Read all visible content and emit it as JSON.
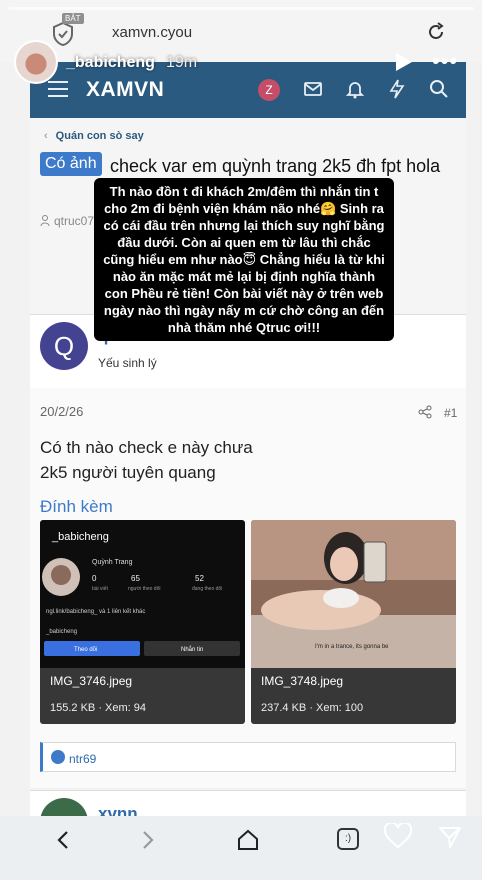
{
  "story": {
    "username": "_babicheng",
    "time": "19m",
    "caption": "Th nào đồn t đi khách 2m/đêm thì nhắn tin t cho 2m đi bệnh viện khám não nhé🤗 Sinh ra có cái đầu trên nhưng lại thích suy nghĩ bằng đầu dưới. Còn ai quen em từ lâu thì chắc cũng hiểu em như nào😇 Chẳng hiểu là từ khi nào ăn mặc mát mẻ lại bị định nghĩa thành con Phều rẻ tiền! Còn bài viết này ở trên web ngày nào thì ngày nấy m cứ chờ công an đến nhà thăm nhé Qtruc ơi!!!"
  },
  "browser": {
    "url": "xamvn.cyou",
    "badge": "BẢT"
  },
  "site": {
    "logo": "XAMVN",
    "user_initial": "Z"
  },
  "thread": {
    "breadcrumb": "Quán con sò say",
    "prefix": "Có ảnh",
    "title": "check var em quỳnh trang 2k5 đh fpt hola",
    "author_short": "qtruc074"
  },
  "post": {
    "avatar_initial": "Q",
    "username": "qtruc07477",
    "role": "Yếu sinh lý",
    "date": "20/2/26",
    "number": "#1",
    "lines": [
      "Có th nào check e này chưa",
      "2k5 người tuyên quang"
    ],
    "attachments_label": "Đính kèm",
    "attachments": [
      {
        "name": "IMG_3746.jpeg",
        "meta": "155.2 KB · Xem: 94"
      },
      {
        "name": "IMG_3748.jpeg",
        "meta": "237.4 KB · Xem: 100"
      }
    ],
    "reaction_user": "ntr69"
  },
  "next_post": {
    "username": "xvnn"
  },
  "thumb1": {
    "username": "_babicheng",
    "display_name": "Quỳnh Trang",
    "stats": [
      {
        "value": "0",
        "label": "bài viết"
      },
      {
        "value": "65",
        "label": "người theo dõi"
      },
      {
        "value": "52",
        "label": "đang theo dõi"
      }
    ],
    "link": "ngl.link/babicheng_ và 1 liên kết khác",
    "handle": "_babicheng",
    "follow_btn": "Theo dõi",
    "message_btn": "Nhắn tin"
  },
  "thumb2": {
    "caption_text": "I'm in a trance, its gonna be"
  }
}
